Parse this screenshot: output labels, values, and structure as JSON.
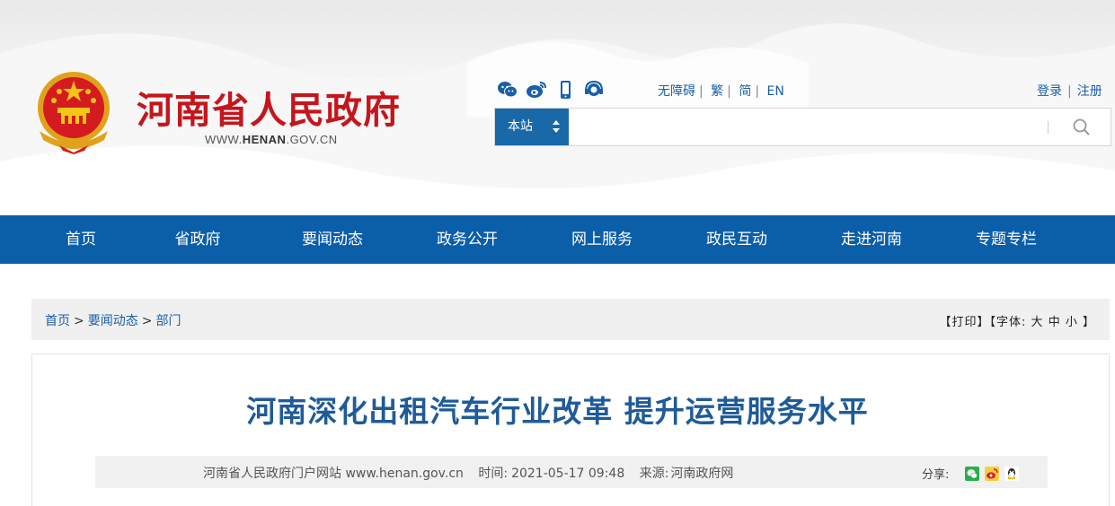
{
  "header": {
    "site_title": "河南省人民政府",
    "site_url_prefix": "WWW.",
    "site_url_brand": "HENAN",
    "site_url_suffix": ".GOV.CN",
    "social_icons": [
      "wechat-icon",
      "weibo-icon",
      "mobile-icon",
      "customer-service-icon"
    ],
    "access_links": [
      "无障碍",
      "繁",
      "简",
      "EN"
    ],
    "auth_links": [
      "登录",
      "注册"
    ],
    "search": {
      "scope": "本站",
      "placeholder": ""
    }
  },
  "nav": {
    "items": [
      "首页",
      "省政府",
      "要闻动态",
      "政务公开",
      "网上服务",
      "政民互动",
      "走进河南",
      "专题专栏"
    ]
  },
  "breadcrumb": {
    "items": [
      "首页",
      "要闻动态",
      "部门"
    ],
    "separator": ">"
  },
  "tools": {
    "print": "【打印】",
    "font_label": "【字体: ",
    "font_large": "大",
    "font_medium": "中",
    "font_small": "小",
    "font_close": " 】"
  },
  "article": {
    "title": "河南深化出租汽车行业改革 提升运营服务水平",
    "site": "河南省人民政府门户网站 www.henan.gov.cn",
    "time_label": "时间:",
    "time": "2021-05-17 09:48",
    "source_label": "来源:",
    "source": "河南政府网",
    "share_label": "分享:",
    "share_icons": [
      "wechat-share-icon",
      "weibo-share-icon",
      "qq-share-icon"
    ]
  },
  "colors": {
    "brand_red": "#c4161c",
    "nav_blue": "#0b5ea8",
    "link_blue": "#1a5fa8",
    "title_blue": "#1f5b98"
  }
}
